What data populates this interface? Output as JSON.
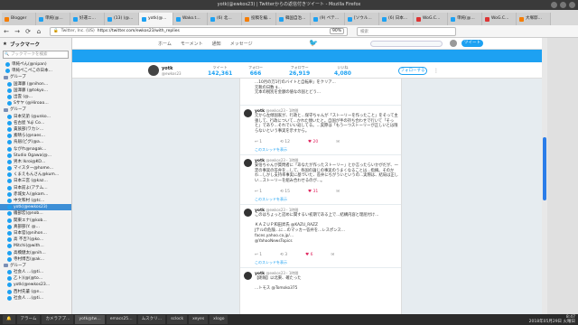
{
  "window": {
    "title": "yotk(@ewkos23) | Twitterからの返信付きツイート - Mozilla Firefox"
  },
  "tabs": [
    {
      "label": "Blogger",
      "active": false,
      "color": "#f57d00"
    },
    {
      "label": "単純(@…",
      "active": false,
      "color": "#1da1f2"
    },
    {
      "label": "好運ニ…",
      "active": false,
      "color": "#1da1f2"
    },
    {
      "label": "(13) (@…",
      "active": false,
      "color": "#1da1f2"
    },
    {
      "label": "yotk(@…",
      "active": true,
      "color": "#1da1f2"
    },
    {
      "label": "Wako.t…",
      "active": false,
      "color": "#1da1f2"
    },
    {
      "label": "(6) 北…",
      "active": false,
      "color": "#1da1f2"
    },
    {
      "label": "投稿を編…",
      "active": false,
      "color": "#f57d00"
    },
    {
      "label": "韓国自治…",
      "active": false,
      "color": "#1da1f2"
    },
    {
      "label": "(9) ペテ…",
      "active": false,
      "color": "#1da1f2"
    },
    {
      "label": "[ソウル…",
      "active": false,
      "color": "#1da1f2"
    },
    {
      "label": "(6) 日本…",
      "active": false,
      "color": "#1da1f2"
    },
    {
      "label": "WoG.C…",
      "active": false,
      "color": "#d33"
    },
    {
      "label": "単純(@…",
      "active": false,
      "color": "#1da1f2"
    },
    {
      "label": "WoG.C…",
      "active": false,
      "color": "#d33"
    },
    {
      "label": "大塚邸…",
      "active": false,
      "color": "#f57d00"
    }
  ],
  "nav": {
    "back": "←",
    "forward": "→",
    "reload": "⟳",
    "home": "⌂",
    "url_host": "Twitter, Inc. (US)",
    "url": "https://twitter.com/ewkos23/with_replies",
    "zoom": "90%",
    "search_placeholder": "検索"
  },
  "sidebar": {
    "title": "ブックマーク",
    "search_placeholder": "ブックマークを検索",
    "items": [
      {
        "label": "単純ぺん(@nipan)",
        "type": "tw",
        "indent": 6
      },
      {
        "label": "単純ぺこぺこの日本…",
        "type": "tw",
        "indent": 6
      },
      {
        "label": "グループ",
        "type": "fd",
        "indent": 4
      },
      {
        "label": "国澤藤 (@nihon…",
        "type": "tw",
        "indent": 8
      },
      {
        "label": "国澤藤 (@tokyo…",
        "type": "tw",
        "indent": 8
      },
      {
        "label": "出雲 (@…",
        "type": "tw",
        "indent": 8
      },
      {
        "label": "Sサヤ (@Hiroao…",
        "type": "tw",
        "indent": 8
      },
      {
        "label": "グループ",
        "type": "fd",
        "indent": 4
      },
      {
        "label": "日本兄弟 (@unko…",
        "type": "tw",
        "indent": 8
      },
      {
        "label": "名古屋 Yuji Co…",
        "type": "tw",
        "indent": 8
      },
      {
        "label": "貴族部(ワカシ…",
        "type": "tw",
        "indent": 8
      },
      {
        "label": "素晴ら(@naes…",
        "type": "tw",
        "indent": 8
      },
      {
        "label": "烏居(ピグ(@a…",
        "type": "tw",
        "indent": 8
      },
      {
        "label": "ながれ@nagak…",
        "type": "tw",
        "indent": 8
      },
      {
        "label": "Studio Ogawa(@…",
        "type": "tw",
        "indent": 8
      },
      {
        "label": "男木 Ikroi@KO…",
        "type": "tw",
        "indent": 8
      },
      {
        "label": "マイスター@home…",
        "type": "tw",
        "indent": 8
      },
      {
        "label": "くまえもんさん@kum…",
        "type": "tw",
        "indent": 8
      },
      {
        "label": "日本三宮 (@kaz…",
        "type": "tw",
        "indent": 8
      },
      {
        "label": "日本前よ(アテム…",
        "type": "tw",
        "indent": 8
      },
      {
        "label": "赤城女人(@kam…",
        "type": "tw",
        "indent": 8
      },
      {
        "label": "中文和村 (@tc…",
        "type": "tw",
        "indent": 8
      },
      {
        "label": "yotk(@ewkos23)",
        "type": "tw",
        "indent": 8,
        "selected": true
      },
      {
        "label": "磯部宏(@nob…",
        "type": "tw",
        "indent": 8
      },
      {
        "label": "関東エナ(@kob…",
        "type": "tw",
        "indent": 8
      },
      {
        "label": "真部部(Y. @…",
        "type": "tw",
        "indent": 8
      },
      {
        "label": "日本官(@nihon…",
        "type": "tw",
        "indent": 8
      },
      {
        "label": "高 不吉?(@ko…",
        "type": "tw",
        "indent": 8
      },
      {
        "label": "Mitchi(@with…",
        "type": "tw",
        "indent": 8
      },
      {
        "label": "高橋健太(@nih…",
        "type": "tw",
        "indent": 8
      },
      {
        "label": "寺村博吉(@ak…",
        "type": "tw",
        "indent": 8
      },
      {
        "label": "グループ",
        "type": "fd",
        "indent": 4
      },
      {
        "label": "社会人 …(@ti…",
        "type": "tw",
        "indent": 8
      },
      {
        "label": "乙ト)(@(@to…",
        "type": "tw",
        "indent": 8
      },
      {
        "label": "yotk(@ewkos23…",
        "type": "tw",
        "indent": 8
      },
      {
        "label": "西村先輩 (@n…",
        "type": "tw",
        "indent": 8
      },
      {
        "label": "社会人 …(@ti…",
        "type": "tw",
        "indent": 8
      }
    ]
  },
  "twitter": {
    "nav_home": "ホーム",
    "nav_moments": "モーメント",
    "nav_notifications": "通知",
    "nav_messages": "メッセージ",
    "tweet_button": "ツイート",
    "profile": {
      "name": "yotk",
      "handle": "@ewkos23",
      "follow": "フォローする",
      "stats": [
        {
          "label": "ツイート",
          "value": "142,361"
        },
        {
          "label": "フォロー",
          "value": "666"
        },
        {
          "label": "フォロワー",
          "value": "26,919"
        },
        {
          "label": "いいね",
          "value": "4,080"
        }
      ]
    }
  },
  "tweets": [
    {
      "name": "",
      "handle": "",
      "time": "",
      "text": "…10月の万1行のバイトと自転車」をクリア…\n元税の日数 $…\n元本の税別を金額の値なの国とどう…",
      "actions": {
        "reply": "",
        "rt": "",
        "fav": ""
      },
      "link": ""
    },
    {
      "name": "yotk",
      "handle": "@ewkos23",
      "time": "1時間",
      "text": "元から左傾国家が、行政と…保守ちゃんが「ストーリーを作ったこと」をそって主張して、行政について…かれた傾いたと。自国が手の持ち合わせで行いて「そっと」であり…それでいい返してる。…実際は「もう一つストーリーが正しいとは限らないという事実を示すから。",
      "actions": {
        "reply": "1",
        "rt": "12",
        "fav": "20"
      },
      "link": "このスレッドを表示"
    },
    {
      "name": "yotk",
      "handle": "@ewkos23",
      "time": "1時間",
      "text": "安倍ちゃんが質問者に「あなたが作ったストーリー」とか言ったらいかがだが、一定の事実の答弁を…して、各国の論じの事実のうまくなることは…指摘。そのかわ…しかし支持率事実に基づいた、答弁にちがういというの…実際は、結局は正しい…ストーリーを組み合わせるのが…。",
      "actions": {
        "reply": "1",
        "rt": "15",
        "fav": "31"
      },
      "link": "このスレッドを表示"
    },
    {
      "name": "yotk",
      "handle": "@ewkos23",
      "time": "1時間",
      "text": "このはちょっと詰めに関するい初期である上で…結構内容と理屈付け…\n\nＫＡＺＵＰ和田昇氏 @KAZU_RAZZ\nJテルの危険…に…のマッカー答弁を…レスポンス…\nfaces.yahoo.co.jp/…\n@YahooNewsTopics",
      "actions": {
        "reply": "1",
        "rt": "3",
        "fav": "6"
      },
      "link": "このスレッドを表示"
    },
    {
      "name": "yotk",
      "handle": "@ewkos23",
      "time": "1時間",
      "text": "【朗報】以北東、確たった\n\n…トモス @Tomoko375",
      "actions": {
        "reply": "",
        "rt": "",
        "fav": ""
      },
      "link": ""
    }
  ],
  "taskbar": {
    "items": [
      {
        "label": "🔔"
      },
      {
        "label": "アラーム"
      },
      {
        "label": "カメラアプ…"
      },
      {
        "label": "yotk@tw…",
        "active": true
      },
      {
        "label": "emacs25…"
      },
      {
        "label": "ムスクリ…"
      },
      {
        "label": "sclock"
      },
      {
        "label": "xeyes"
      },
      {
        "label": "xlogo"
      }
    ],
    "time": "8:47",
    "date": "2018年05月29日 火曜日"
  }
}
